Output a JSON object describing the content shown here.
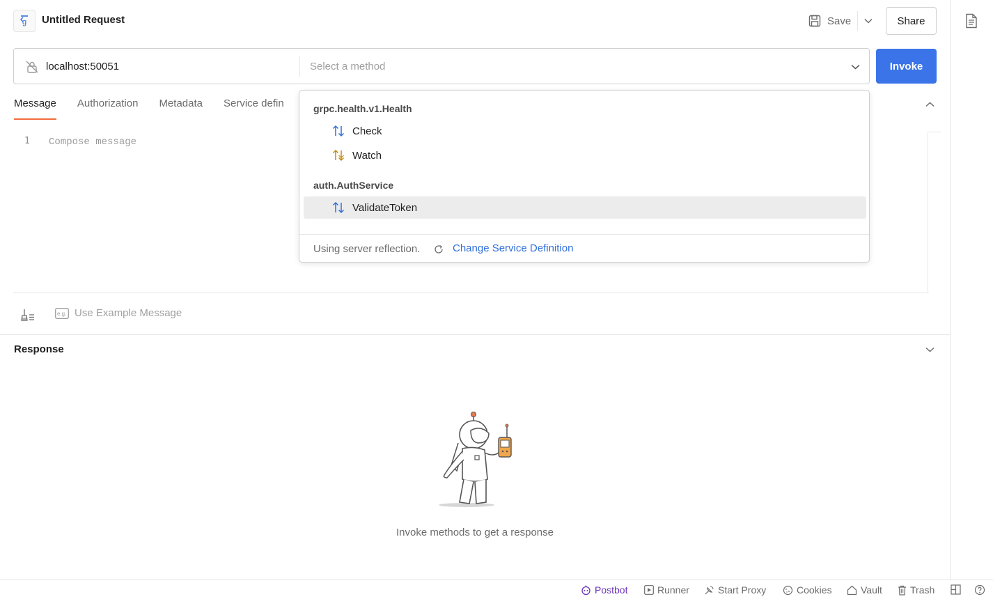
{
  "header": {
    "title": "Untitled Request",
    "save_label": "Save",
    "share_label": "Share"
  },
  "urlbar": {
    "url": "localhost:50051",
    "method_placeholder": "Select a method",
    "invoke_label": "Invoke"
  },
  "tabs": [
    {
      "label": "Message",
      "active": true
    },
    {
      "label": "Authorization"
    },
    {
      "label": "Metadata"
    },
    {
      "label": "Service defin"
    }
  ],
  "editor": {
    "line_number": "1",
    "placeholder": "Compose message"
  },
  "tools": {
    "example_label": "Use Example Message"
  },
  "response": {
    "title": "Response",
    "empty_text": "Invoke methods to get a response"
  },
  "dropdown": {
    "groups": [
      {
        "name": "grpc.health.v1.Health",
        "methods": [
          {
            "label": "Check",
            "type": "unary",
            "color": "#2f6fdb"
          },
          {
            "label": "Watch",
            "type": "server-streaming",
            "color": "#c58a1a"
          }
        ]
      },
      {
        "name": "auth.AuthService",
        "methods": [
          {
            "label": "ValidateToken",
            "type": "unary",
            "color": "#2f6fdb",
            "highlighted": true
          }
        ]
      }
    ],
    "footer_text": "Using server reflection.",
    "footer_link": "Change Service Definition"
  },
  "statusbar": {
    "postbot": "Postbot",
    "runner": "Runner",
    "start_proxy": "Start Proxy",
    "cookies": "Cookies",
    "vault": "Vault",
    "trash": "Trash"
  },
  "colors": {
    "accent": "#3b74e8",
    "tab_underline": "#f26b3a",
    "link": "#2f6fdb",
    "postbot": "#6b35b8"
  }
}
